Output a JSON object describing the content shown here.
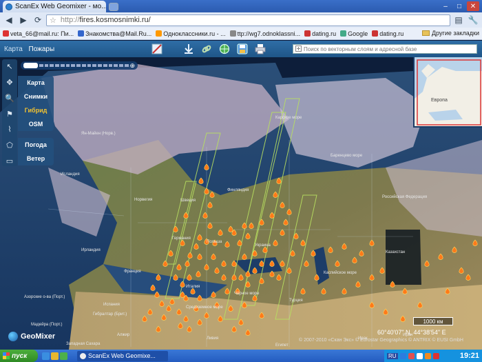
{
  "browser": {
    "tab_title": "ScanEx Web Geomixer - мо...",
    "url_proto": "http://",
    "url_rest": "fires.kosmosnimki.ru/"
  },
  "bookmarks": {
    "items": [
      {
        "label": "veta_66@mail.ru: Пи...",
        "color": "#d33"
      },
      {
        "label": "Знакомства@Mail.Ru...",
        "color": "#36c"
      },
      {
        "label": "Одноклассники.ru - ...",
        "color": "#f90"
      },
      {
        "label": "ttp://wg7.odnoklassni...",
        "color": "#888"
      },
      {
        "label": "dating.ru",
        "color": "#c33"
      },
      {
        "label": "Google",
        "color": "#4a8"
      },
      {
        "label": "dating.ru",
        "color": "#c33"
      }
    ],
    "other": "Другие закладки"
  },
  "app": {
    "crumb_root": "Карта",
    "crumb_current": "Пожары",
    "search_placeholder": "Поиск по векторным слоям и адресной базе"
  },
  "layers": {
    "base": [
      "Карта",
      "Снимки",
      "Гибрид",
      "OSM"
    ],
    "active": "Гибрид",
    "extra": [
      "Погода",
      "Ветер"
    ]
  },
  "map": {
    "overview_label": "Европа",
    "scale": "1000 км",
    "coords": "60°40'07\" N, 44°38'54\" E",
    "copyright": "© 2007-2010 «Скан Экс» © Eurostar Geographics © ANTRIX © EUSI GmbH",
    "logo": "GeoMixer",
    "labels": [
      {
        "text": "Ян-Майен (Норв.)"
      },
      {
        "text": "Норвегия"
      },
      {
        "text": "Швеция"
      },
      {
        "text": "Финляндия"
      },
      {
        "text": "Исландия"
      },
      {
        "text": "Ирландия"
      },
      {
        "text": "Франция"
      },
      {
        "text": "Испания"
      },
      {
        "text": "Германия"
      },
      {
        "text": "Польша"
      },
      {
        "text": "Украина"
      },
      {
        "text": "Италия"
      },
      {
        "text": "Турция"
      },
      {
        "text": "Казахстан"
      },
      {
        "text": "Российская Федерация"
      },
      {
        "text": "Алжир"
      },
      {
        "text": "Ливия"
      },
      {
        "text": "Египет"
      },
      {
        "text": "Ирак"
      },
      {
        "text": "Иран"
      },
      {
        "text": "Азорские о-ва (Порт.)"
      },
      {
        "text": "Мадейра (Порт.)"
      },
      {
        "text": "Гибралтар (Брит.)"
      },
      {
        "text": "Западная Сахара"
      },
      {
        "text": "Карское море"
      },
      {
        "text": "Баренцево море"
      },
      {
        "text": "Средиземное море"
      },
      {
        "text": "Чёрное море"
      },
      {
        "text": "Каспийское море"
      }
    ]
  },
  "taskbar": {
    "start": "пуск",
    "task": "ScanEx Web Geomixe...",
    "lang": "RU",
    "clock": "19:21"
  }
}
